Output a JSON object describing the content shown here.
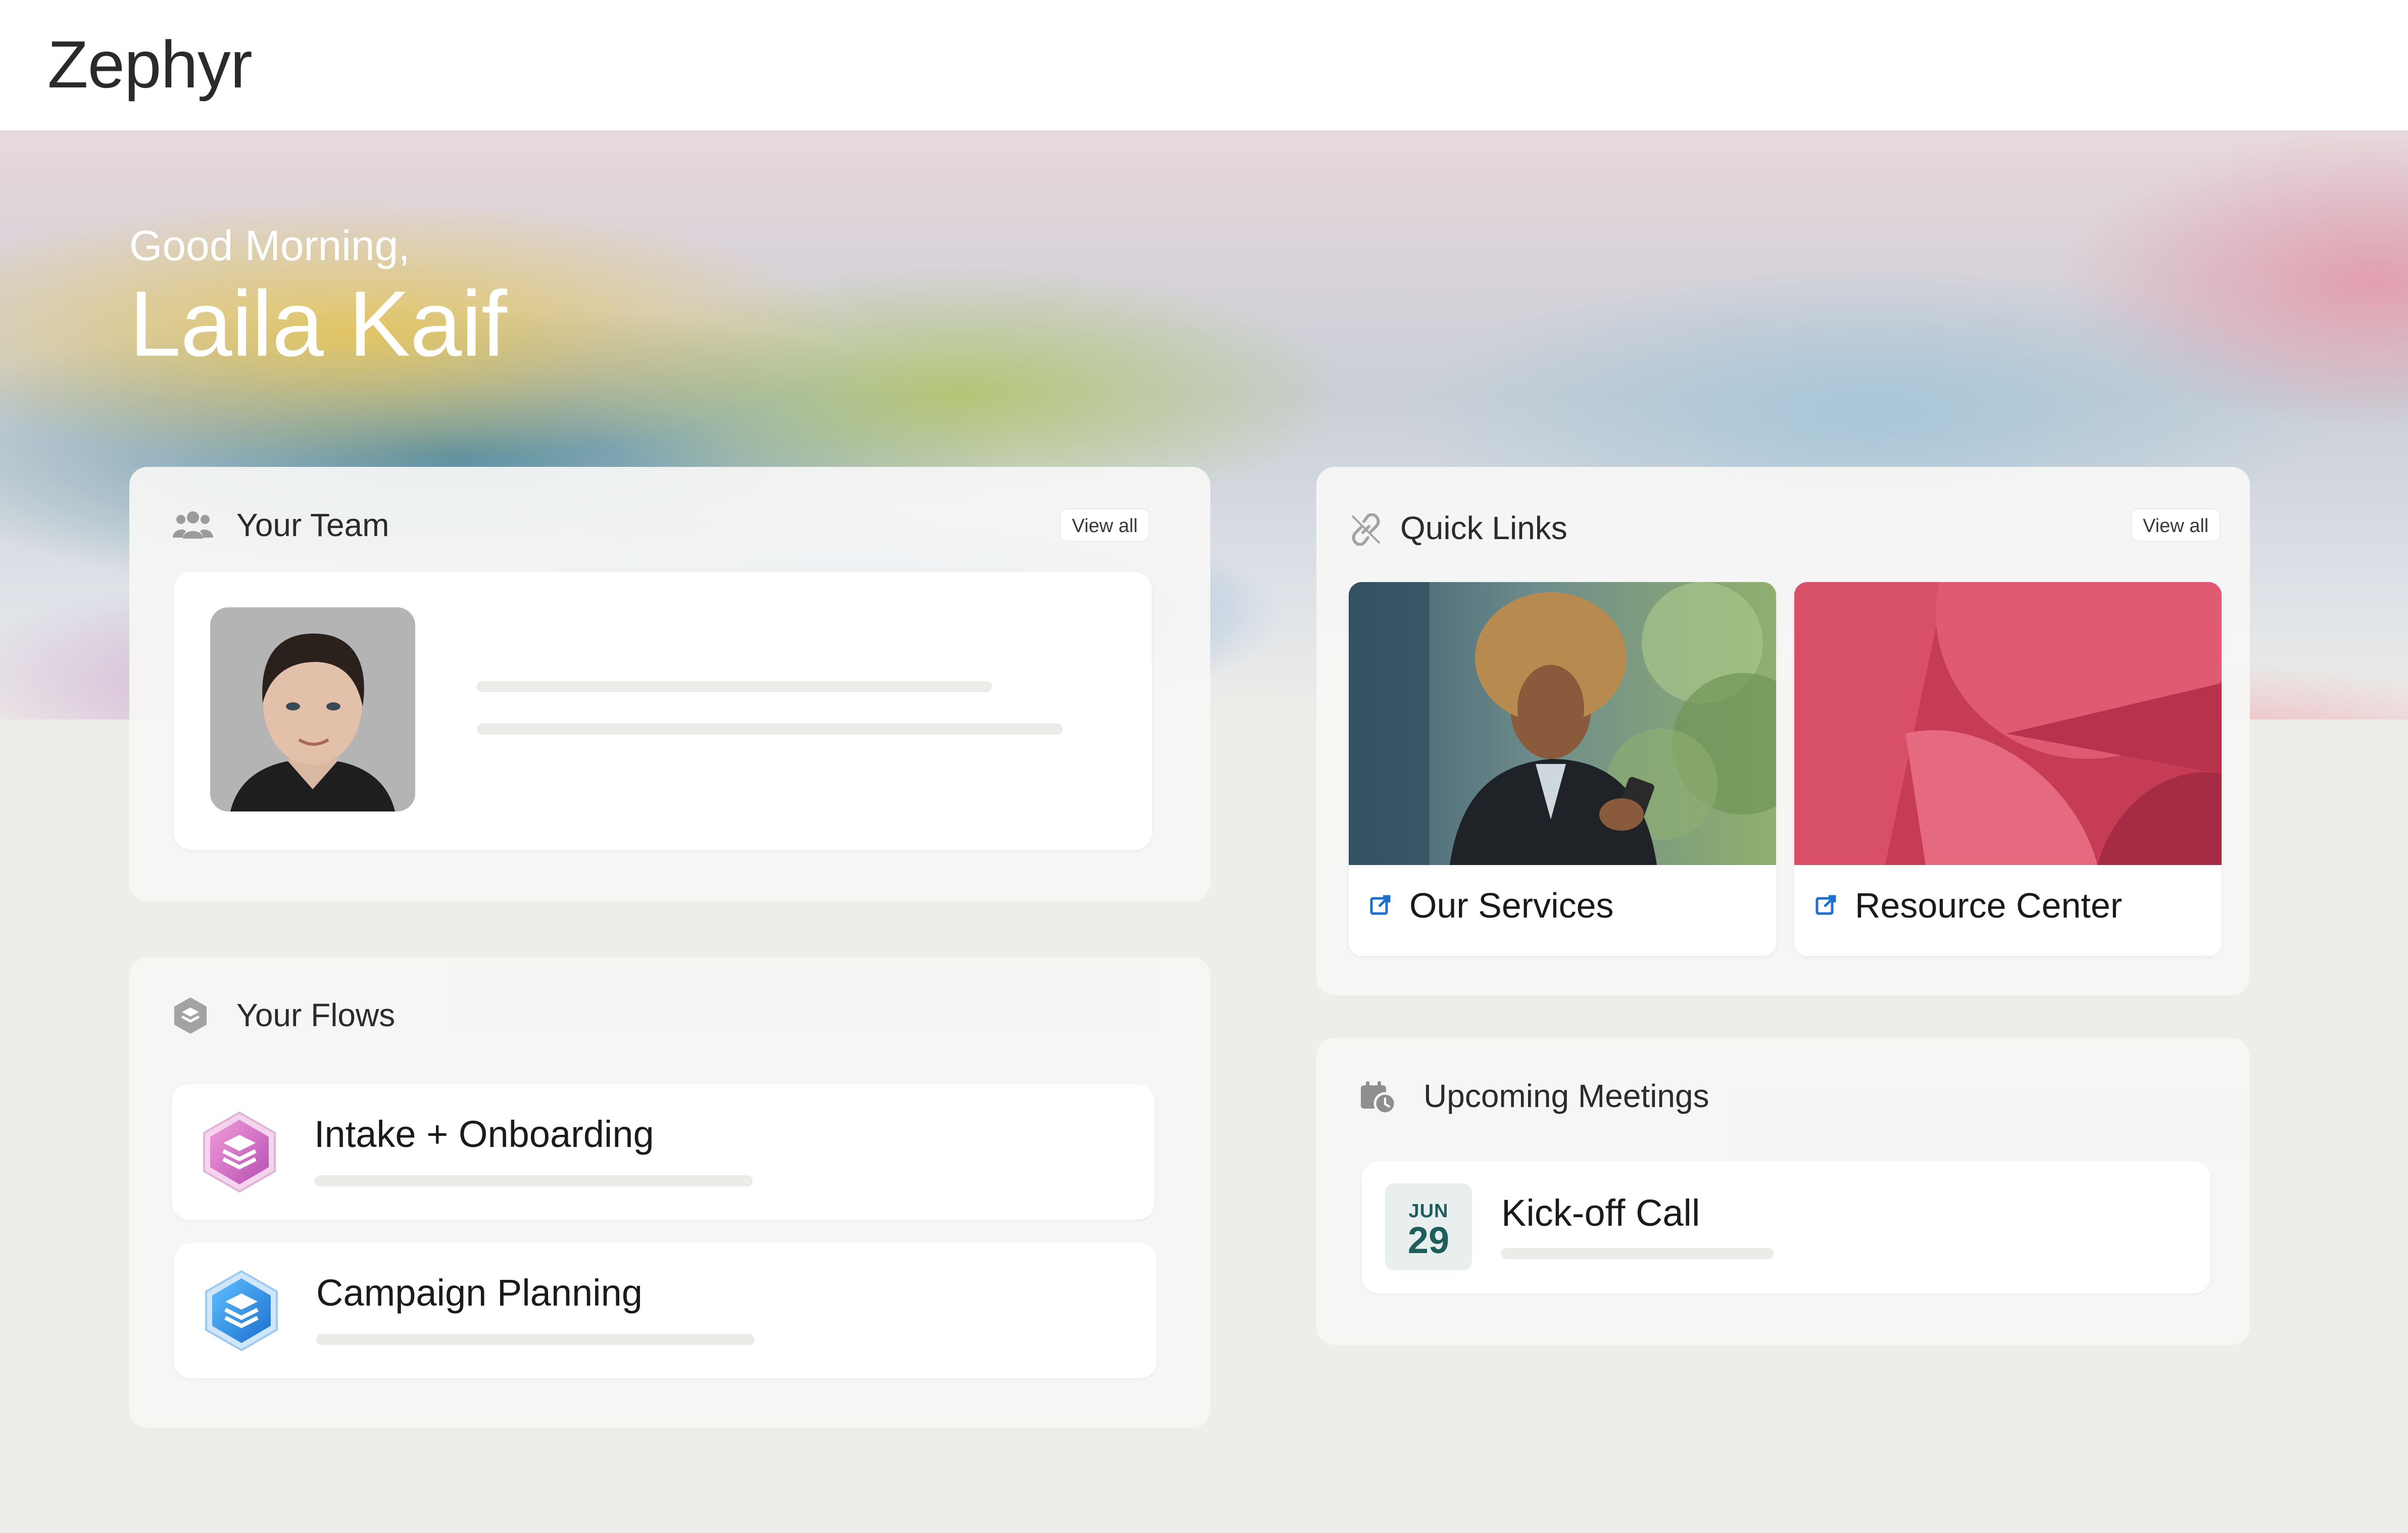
{
  "app": {
    "brand": "Zephyr"
  },
  "hero": {
    "greeting": "Good Morning,",
    "user_name": "Laila Kaif"
  },
  "team": {
    "title": "Your Team",
    "icon": "users-icon",
    "view_all": "View all"
  },
  "flows": {
    "title": "Your Flows",
    "icon": "flows-icon",
    "items": [
      {
        "label": "Intake + Onboarding",
        "icon": "layers-hex-icon",
        "color": "#d873c8"
      },
      {
        "label": "Campaign Planning",
        "icon": "layers-hex-icon",
        "color": "#2e8fe0"
      }
    ]
  },
  "quick_links": {
    "title": "Quick Links",
    "icon": "link-icon",
    "view_all": "View all",
    "items": [
      {
        "label": "Our Services",
        "icon": "external-link-icon"
      },
      {
        "label": "Resource Center",
        "icon": "external-link-icon"
      }
    ]
  },
  "meetings": {
    "title": "Upcoming Meetings",
    "icon": "calendar-clock-icon",
    "items": [
      {
        "month": "JUN",
        "day": "29",
        "title": "Kick-off Call"
      }
    ]
  },
  "colors": {
    "accent_link": "#1f6fd1",
    "date_badge_text": "#1d5e5a",
    "page_bg": "#eeede9"
  }
}
